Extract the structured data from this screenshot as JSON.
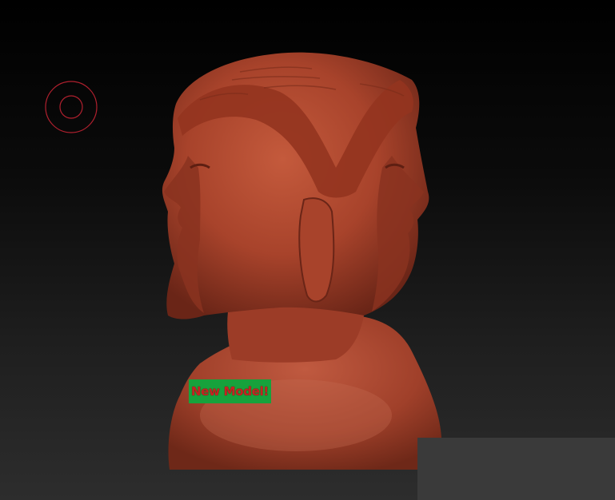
{
  "viewport": {
    "background_top": "#000000",
    "background_bottom": "#2d2d2d"
  },
  "brush": {
    "icon": "brush-cursor-icon",
    "color": "#b0202e"
  },
  "model": {
    "name": "two-faced-bust",
    "material_color": "#a8432b",
    "highlight_color": "#c45a3c",
    "shadow_color": "#6a2517"
  },
  "badge": {
    "label": "New Model!",
    "background": "#17a23c",
    "text_color": "#c62222"
  },
  "panel": {
    "color": "#3a3a3a"
  }
}
